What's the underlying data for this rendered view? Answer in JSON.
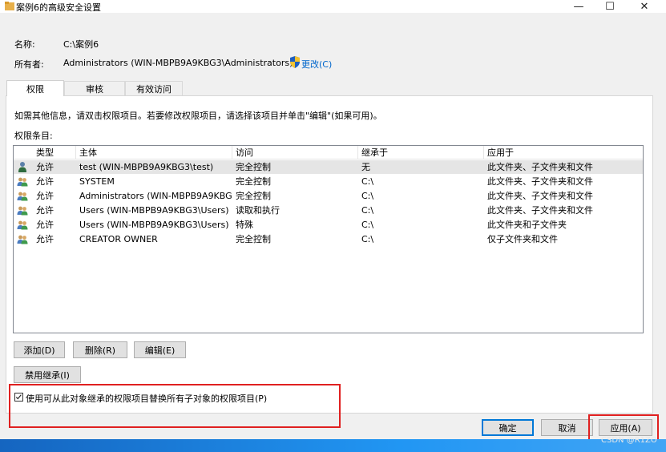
{
  "window": {
    "title": "案例6的高级安全设置",
    "minimize": "—",
    "maximize": "☐",
    "close": "✕"
  },
  "info": {
    "name_label": "名称:",
    "name_value": "C:\\案例6",
    "owner_label": "所有者:",
    "owner_value": "Administrators (WIN-MBPB9A9KBG3\\Administrators)",
    "change_link": "更改(C)"
  },
  "tabs": [
    {
      "label": "权限",
      "active": true
    },
    {
      "label": "审核",
      "active": false
    },
    {
      "label": "有效访问",
      "active": false
    }
  ],
  "hint_text": "如需其他信息，请双击权限项目。若要修改权限项目，请选择该项目并单击\"编辑\"(如果可用)。",
  "entries_label": "权限条目:",
  "table": {
    "columns": [
      "类型",
      "主体",
      "访问",
      "继承于",
      "应用于"
    ],
    "rows": [
      {
        "icon": "user-icon",
        "type": "允许",
        "principal": "test (WIN-MBPB9A9KBG3\\test)",
        "access": "完全控制",
        "inherited": "无",
        "applies": "此文件夹、子文件夹和文件"
      },
      {
        "icon": "group-icon",
        "type": "允许",
        "principal": "SYSTEM",
        "access": "完全控制",
        "inherited": "C:\\",
        "applies": "此文件夹、子文件夹和文件"
      },
      {
        "icon": "group-icon",
        "type": "允许",
        "principal": "Administrators (WIN-MBPB9A9KBG...",
        "access": "完全控制",
        "inherited": "C:\\",
        "applies": "此文件夹、子文件夹和文件"
      },
      {
        "icon": "group-icon",
        "type": "允许",
        "principal": "Users (WIN-MBPB9A9KBG3\\Users)",
        "access": "读取和执行",
        "inherited": "C:\\",
        "applies": "此文件夹、子文件夹和文件"
      },
      {
        "icon": "group-icon",
        "type": "允许",
        "principal": "Users (WIN-MBPB9A9KBG3\\Users)",
        "access": "特殊",
        "inherited": "C:\\",
        "applies": "此文件夹和子文件夹"
      },
      {
        "icon": "group-icon",
        "type": "允许",
        "principal": "CREATOR OWNER",
        "access": "完全控制",
        "inherited": "C:\\",
        "applies": "仅子文件夹和文件"
      }
    ]
  },
  "buttons": {
    "add": "添加(D)",
    "remove": "删除(R)",
    "edit": "编辑(E)",
    "disable_inheritance": "禁用继承(I)",
    "ok": "确定",
    "cancel": "取消",
    "apply": "应用(A)"
  },
  "replace_checkbox": {
    "label": "使用可从此对象继承的权限项目替换所有子对象的权限项目(P)",
    "checked": true
  },
  "watermark": "CSDN @R1ZO",
  "colors": {
    "highlight_box": "#e02020",
    "link": "#0066cc",
    "taskbar": "#1e88e5"
  }
}
